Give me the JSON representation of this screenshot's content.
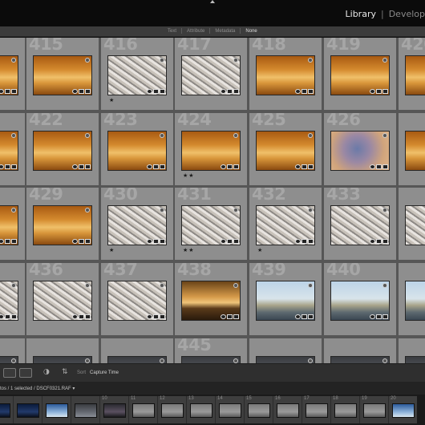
{
  "topbar": {
    "modules": [
      {
        "label": "Library",
        "active": true
      },
      {
        "label": "Develop",
        "active": false
      }
    ]
  },
  "filter": {
    "items": [
      {
        "label": "Text",
        "active": false
      },
      {
        "label": "Attribute",
        "active": false
      },
      {
        "label": "Metadata",
        "active": false
      },
      {
        "label": "None",
        "active": true
      }
    ]
  },
  "grid": {
    "columns": 7,
    "rows": [
      [
        {
          "num": "",
          "img": "gold",
          "stars": ""
        },
        {
          "num": "415",
          "img": "gold",
          "stars": ""
        },
        {
          "num": "416",
          "img": "flock",
          "stars": "★"
        },
        {
          "num": "417",
          "img": "flock",
          "stars": ""
        },
        {
          "num": "418",
          "img": "gold",
          "stars": ""
        },
        {
          "num": "419",
          "img": "gold",
          "stars": ""
        },
        {
          "num": "420",
          "img": "gold",
          "stars": ""
        }
      ],
      [
        {
          "num": "",
          "img": "gold",
          "stars": ""
        },
        {
          "num": "422",
          "img": "gold",
          "stars": ""
        },
        {
          "num": "423",
          "img": "gold",
          "stars": ""
        },
        {
          "num": "424",
          "img": "gold",
          "stars": "★★"
        },
        {
          "num": "425",
          "img": "gold",
          "stars": ""
        },
        {
          "num": "426",
          "img": "blur",
          "stars": ""
        },
        {
          "num": "",
          "img": "gold",
          "stars": ""
        }
      ],
      [
        {
          "num": "",
          "img": "gold",
          "stars": ""
        },
        {
          "num": "429",
          "img": "gold",
          "stars": ""
        },
        {
          "num": "430",
          "img": "flock",
          "stars": "★"
        },
        {
          "num": "431",
          "img": "flock",
          "stars": "★★"
        },
        {
          "num": "432",
          "img": "flock",
          "stars": "★"
        },
        {
          "num": "433",
          "img": "flock",
          "stars": ""
        },
        {
          "num": "",
          "img": "flock",
          "stars": ""
        }
      ],
      [
        {
          "num": "",
          "img": "flock",
          "stars": ""
        },
        {
          "num": "436",
          "img": "flock",
          "stars": ""
        },
        {
          "num": "437",
          "img": "flock",
          "stars": ""
        },
        {
          "num": "438",
          "img": "sunset",
          "stars": ""
        },
        {
          "num": "439",
          "img": "trees",
          "stars": ""
        },
        {
          "num": "440",
          "img": "trees",
          "stars": ""
        },
        {
          "num": "",
          "img": "trees",
          "stars": ""
        }
      ],
      [
        {
          "num": "443",
          "img": "dark",
          "stars": ""
        },
        {
          "num": "",
          "img": "dark",
          "stars": ""
        },
        {
          "num": "",
          "img": "dark",
          "stars": ""
        },
        {
          "num": "445",
          "img": "dark",
          "stars": ""
        },
        {
          "num": "",
          "img": "dark",
          "stars": ""
        },
        {
          "num": "",
          "img": "dark",
          "stars": ""
        },
        {
          "num": "",
          "img": "dark",
          "stars": ""
        }
      ]
    ]
  },
  "toolbar": {
    "sort_label": "Sort",
    "sort_value": "Capture Time"
  },
  "filmstrip": {
    "path_prefix": "tos / 1 selected / DSCF0321.RAF ▾",
    "cells": [
      {
        "num": "",
        "img": "night"
      },
      {
        "num": "",
        "img": "night"
      },
      {
        "num": "",
        "img": "blue"
      },
      {
        "num": "",
        "img": "dark"
      },
      {
        "num": "",
        "img": "dusk"
      },
      {
        "num": "",
        "img": "gray"
      },
      {
        "num": "",
        "img": "gray"
      },
      {
        "num": "",
        "img": "gray"
      },
      {
        "num": "",
        "img": "gray"
      },
      {
        "num": "",
        "img": "gray"
      },
      {
        "num": "",
        "img": "gray"
      },
      {
        "num": "",
        "img": "gray"
      },
      {
        "num": "",
        "img": "gray"
      },
      {
        "num": "",
        "img": "gray"
      },
      {
        "num": "",
        "img": "blue"
      }
    ],
    "numbers": [
      "10",
      "11",
      "12",
      "13",
      "14",
      "15",
      "16",
      "17",
      "18",
      "19",
      "20"
    ]
  },
  "colors": {
    "gold": "#d38a2a",
    "accent_text": "#e8e8e8"
  },
  "icons": [
    "up-arrow-icon",
    "grid-view-icon",
    "loupe-view-icon",
    "painter-icon",
    "sort-direction-icon",
    "badge-icon",
    "metadata-icon",
    "crop-icon",
    "develop-icon"
  ]
}
